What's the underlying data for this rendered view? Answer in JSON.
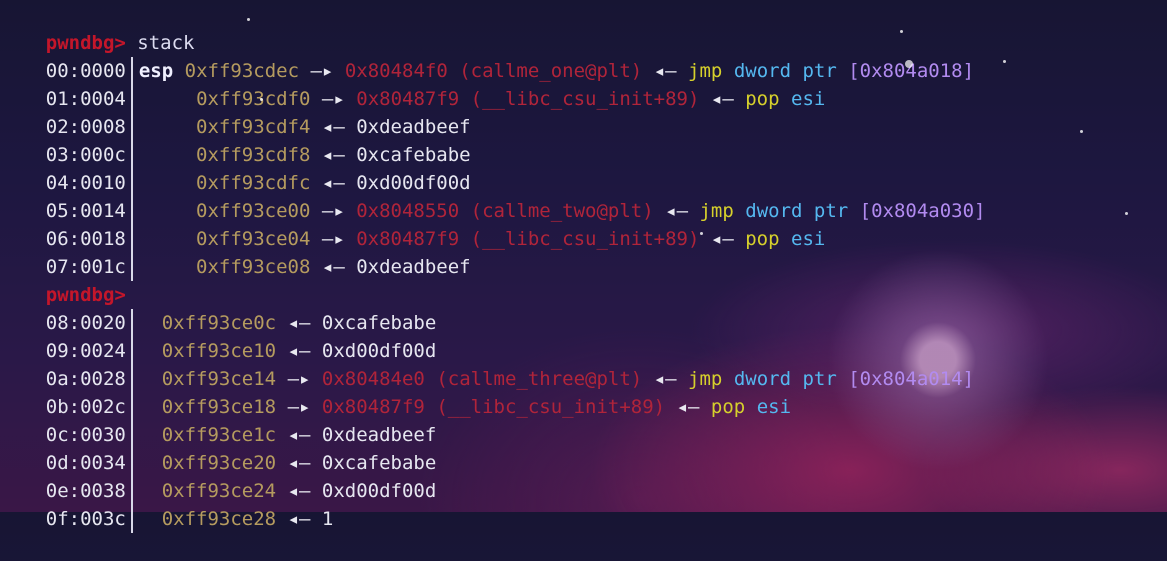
{
  "prompt1": "pwndbg>",
  "command1": "stack",
  "prompt2": "pwndbg>",
  "rows": [
    {
      "idx": "00:0000",
      "reg": "esp",
      "addr": "0xff93cdec",
      "arrow": "—▸",
      "ptr": "0x80484f0",
      "sym": "(callme_one@plt)",
      "arr2": "◂—",
      "mnem": "jmp",
      "kw": "dword ptr",
      "operand": "[0x804a018]"
    },
    {
      "idx": "01:0004",
      "reg": "",
      "addr": "0xff93cdf0",
      "arrow": "—▸",
      "ptr": "0x80487f9",
      "sym": "(__libc_csu_init+89)",
      "arr2": "◂—",
      "mnem": "pop",
      "kw": "esi",
      "operand": ""
    },
    {
      "idx": "02:0008",
      "reg": "",
      "addr": "0xff93cdf4",
      "arrow": "◂—",
      "val": "0xdeadbeef"
    },
    {
      "idx": "03:000c",
      "reg": "",
      "addr": "0xff93cdf8",
      "arrow": "◂—",
      "val": "0xcafebabe"
    },
    {
      "idx": "04:0010",
      "reg": "",
      "addr": "0xff93cdfc",
      "arrow": "◂—",
      "val": "0xd00df00d"
    },
    {
      "idx": "05:0014",
      "reg": "",
      "addr": "0xff93ce00",
      "arrow": "—▸",
      "ptr": "0x8048550",
      "sym": "(callme_two@plt)",
      "arr2": "◂—",
      "mnem": "jmp",
      "kw": "dword ptr",
      "operand": "[0x804a030]"
    },
    {
      "idx": "06:0018",
      "reg": "",
      "addr": "0xff93ce04",
      "arrow": "—▸",
      "ptr": "0x80487f9",
      "sym": "(__libc_csu_init+89)",
      "arr2": "◂—",
      "mnem": "pop",
      "kw": "esi",
      "operand": ""
    },
    {
      "idx": "07:001c",
      "reg": "",
      "addr": "0xff93ce08",
      "arrow": "◂—",
      "val": "0xdeadbeef"
    }
  ],
  "rows2": [
    {
      "idx": "08:0020",
      "addr": "0xff93ce0c",
      "arrow": "◂—",
      "val": "0xcafebabe"
    },
    {
      "idx": "09:0024",
      "addr": "0xff93ce10",
      "arrow": "◂—",
      "val": "0xd00df00d"
    },
    {
      "idx": "0a:0028",
      "addr": "0xff93ce14",
      "arrow": "—▸",
      "ptr": "0x80484e0",
      "sym": "(callme_three@plt)",
      "arr2": "◂—",
      "mnem": "jmp",
      "kw": "dword ptr",
      "operand": "[0x804a014]"
    },
    {
      "idx": "0b:002c",
      "addr": "0xff93ce18",
      "arrow": "—▸",
      "ptr": "0x80487f9",
      "sym": "(__libc_csu_init+89)",
      "arr2": "◂—",
      "mnem": "pop",
      "kw": "esi",
      "operand": ""
    },
    {
      "idx": "0c:0030",
      "addr": "0xff93ce1c",
      "arrow": "◂—",
      "val": "0xdeadbeef"
    },
    {
      "idx": "0d:0034",
      "addr": "0xff93ce20",
      "arrow": "◂—",
      "val": "0xcafebabe"
    },
    {
      "idx": "0e:0038",
      "addr": "0xff93ce24",
      "arrow": "◂—",
      "val": "0xd00df00d"
    },
    {
      "idx": "0f:003c",
      "addr": "0xff93ce28",
      "arrow": "◂—",
      "val": "1"
    }
  ],
  "colors": {
    "prompt": "#c4162a",
    "address": "#b59b5f",
    "pointer": "#b0243a",
    "mnemonic": "#d6d02c",
    "keyword": "#55b8f0",
    "operand": "#b28bf0"
  }
}
